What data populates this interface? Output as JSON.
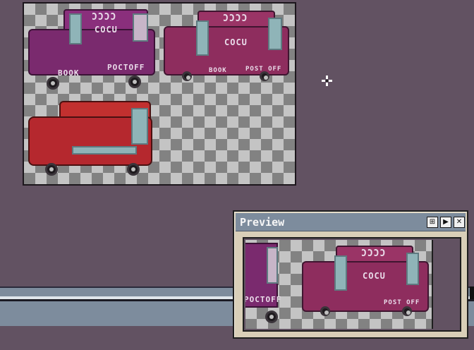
{
  "canvas": {
    "sprites": [
      {
        "name": "purple-car-side",
        "body_color": "#7a2a6e",
        "graffiti": [
          "ƆƆƆƆ",
          "COCU",
          "POCTOFF",
          "BOOK"
        ]
      },
      {
        "name": "pink-car-isometric",
        "body_color": "#8e2d5e",
        "graffiti": [
          "ƆƆƆƆ",
          "COCU",
          "POST OFF",
          "BOOK"
        ]
      },
      {
        "name": "red-car",
        "body_color": "#b5282e",
        "graffiti": []
      }
    ]
  },
  "preview": {
    "title": "Preview",
    "buttons": {
      "fit_icon": "⊞",
      "play_icon": "▶",
      "close_icon": "✕"
    },
    "graffiti": [
      "ƆƆƆƆ",
      "COCU",
      "POCTOFF",
      "POST OFF"
    ]
  },
  "cursor": {
    "icon": "crosshair-move-icon"
  },
  "colors": {
    "workspace": "#625262",
    "titlebar": "#7d8c9d",
    "window_bg": "#d9cfb8"
  }
}
